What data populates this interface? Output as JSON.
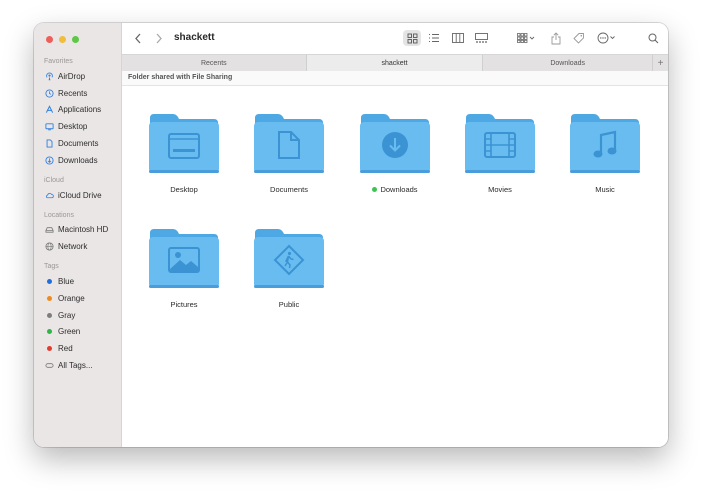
{
  "window": {
    "title": "shackett"
  },
  "sidebar": {
    "sections": [
      {
        "heading": "Favorites",
        "items": [
          {
            "label": "AirDrop",
            "icon": "airdrop-icon"
          },
          {
            "label": "Recents",
            "icon": "clock-icon"
          },
          {
            "label": "Applications",
            "icon": "applications-icon"
          },
          {
            "label": "Desktop",
            "icon": "desktop-icon"
          },
          {
            "label": "Documents",
            "icon": "document-icon"
          },
          {
            "label": "Downloads",
            "icon": "download-icon"
          }
        ]
      },
      {
        "heading": "iCloud",
        "items": [
          {
            "label": "iCloud Drive",
            "icon": "cloud-icon"
          }
        ]
      },
      {
        "heading": "Locations",
        "items": [
          {
            "label": "Macintosh HD",
            "icon": "harddrive-icon"
          },
          {
            "label": "Network",
            "icon": "network-icon"
          }
        ]
      },
      {
        "heading": "Tags",
        "items": [
          {
            "label": "Blue",
            "color": "#1f6fe0"
          },
          {
            "label": "Orange",
            "color": "#f08a1c"
          },
          {
            "label": "Gray",
            "color": "#7d7d7d"
          },
          {
            "label": "Green",
            "color": "#2fb548"
          },
          {
            "label": "Red",
            "color": "#e23b30"
          },
          {
            "label": "All Tags...",
            "icon": "tag-outline-icon"
          }
        ]
      }
    ]
  },
  "tabs": [
    {
      "label": "Recents",
      "active": false
    },
    {
      "label": "shackett",
      "active": true
    },
    {
      "label": "Downloads",
      "active": false
    }
  ],
  "shared_banner": "Folder shared with File Sharing",
  "folders": [
    {
      "label": "Desktop",
      "glyph": "desktop-glyph-icon"
    },
    {
      "label": "Documents",
      "glyph": "document-glyph-icon"
    },
    {
      "label": "Downloads",
      "glyph": "download-glyph-icon",
      "status": "green"
    },
    {
      "label": "Movies",
      "glyph": "film-glyph-icon"
    },
    {
      "label": "Music",
      "glyph": "music-glyph-icon"
    },
    {
      "label": "Pictures",
      "glyph": "picture-glyph-icon"
    },
    {
      "label": "Public",
      "glyph": "public-glyph-icon"
    }
  ],
  "colors": {
    "folder_body": "#68bcef",
    "folder_back": "#4ea8e4",
    "folder_glyph": "#3b93d3"
  }
}
